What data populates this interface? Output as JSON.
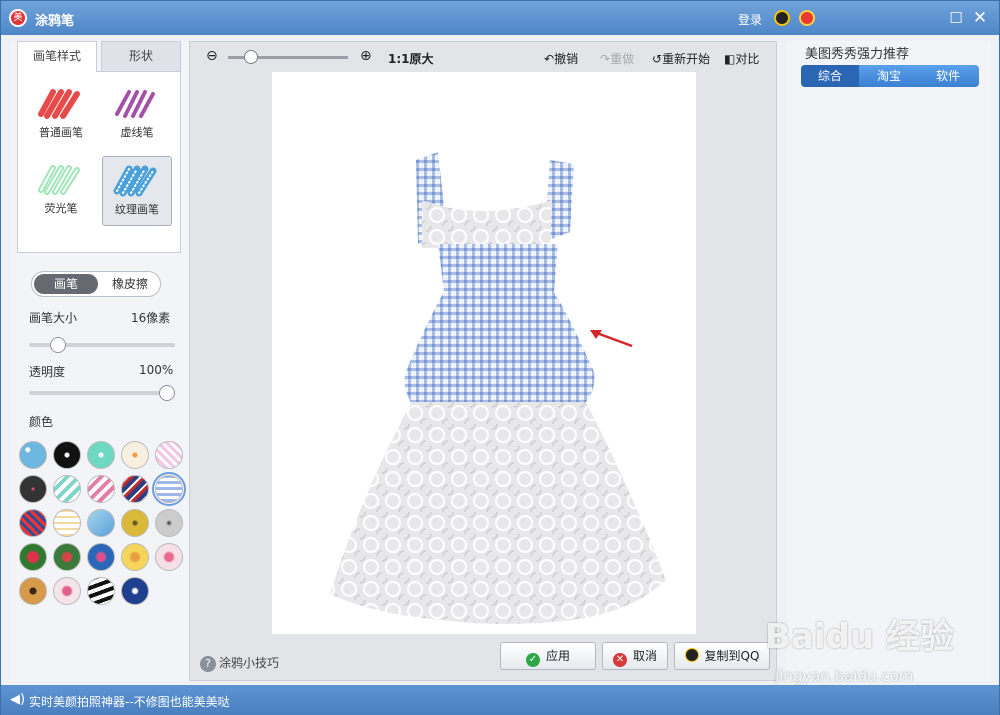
{
  "app": {
    "title": "涂鸦笔",
    "login": "登录",
    "logo_text": "美"
  },
  "left": {
    "tabs": [
      "画笔样式",
      "形状"
    ],
    "brushes": [
      "普通画笔",
      "虚线笔",
      "荧光笔",
      "纹理画笔"
    ],
    "mode": {
      "pen": "画笔",
      "eraser": "橡皮擦"
    },
    "size": {
      "label": "画笔大小",
      "value": "16像素",
      "level": 0.16
    },
    "opacity": {
      "label": "透明度",
      "value": "100%",
      "level": 1.0
    },
    "colors_label": "颜色",
    "swatch_rows": 5
  },
  "toolbar": {
    "ratio": "1:1",
    "original": "原大",
    "undo": "撤销",
    "redo": "重做",
    "restart": "重新开始",
    "compare": "对比",
    "zoom_level": 0.15
  },
  "bottom": {
    "tip": "涂鸦小技巧",
    "apply": "应用",
    "cancel": "取消",
    "copy_qq": "复制到QQ"
  },
  "right": {
    "title": "美图秀秀强力推荐",
    "tabs": [
      "综合",
      "淘宝",
      "软件"
    ]
  },
  "status": {
    "text": "实时美颜拍照神器--不修图也能美美哒"
  },
  "watermark": {
    "brand": "Baidu 经验",
    "url": "jingyan.baidu.com"
  }
}
